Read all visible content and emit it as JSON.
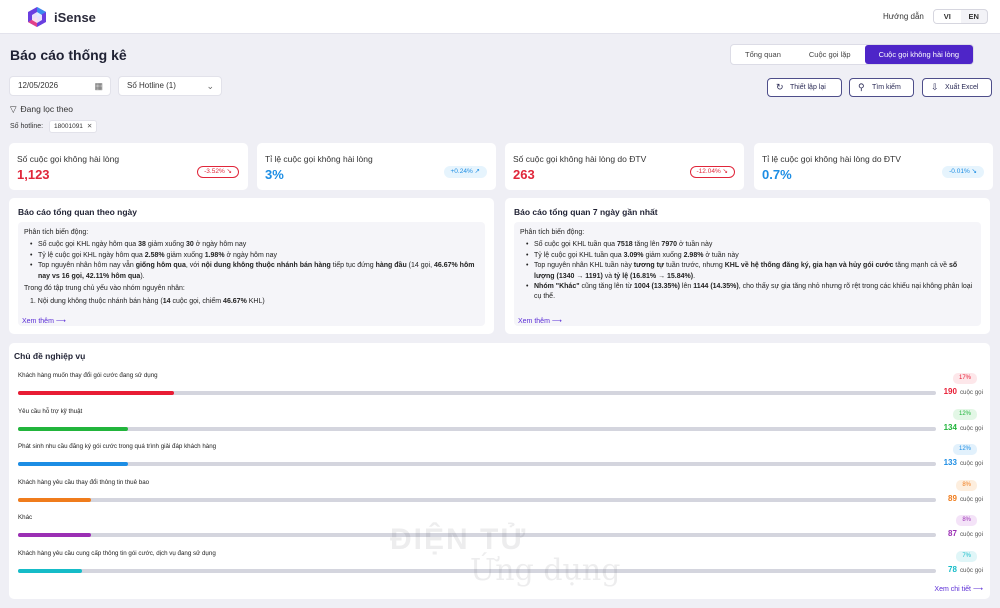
{
  "app": {
    "brand": "iSense",
    "guide": "Hướng dẫn",
    "lang_vi": "VI",
    "lang_en": "EN"
  },
  "page": {
    "title": "Báo cáo thống kê"
  },
  "tabs": [
    {
      "label": "Tổng quan",
      "active": false
    },
    {
      "label": "Cuộc gọi lặp",
      "active": false
    },
    {
      "label": "Cuộc gọi không hài lòng",
      "active": true
    }
  ],
  "filters": {
    "date": "12/05/2026",
    "hotline_select": "Số Hotline (1)",
    "active_label": "Đang lọc theo",
    "hotline_label": "Số hotline:",
    "hotline_chip": "18001091"
  },
  "actions": {
    "reset": "Thiết lập lại",
    "search": "Tìm kiếm",
    "export": "Xuất Excel"
  },
  "kpis": [
    {
      "label": "Số cuộc gọi không hài lòng",
      "value": "1,123",
      "badge": "-3.52%",
      "trend": "down",
      "value_color": "#e0263a"
    },
    {
      "label": "Tỉ lệ cuộc gọi không hài lòng",
      "value": "3%",
      "badge": "+0.24%",
      "trend": "up",
      "value_color": "#1c8de4"
    },
    {
      "label": "Số cuộc gọi không hài lòng do ĐTV",
      "value": "263",
      "badge": "-12.04%",
      "trend": "down",
      "value_color": "#e0263a"
    },
    {
      "label": "Tỉ lệ cuộc gọi không hài lòng do ĐTV",
      "value": "0.7%",
      "badge": "-0.01%",
      "trend": "up",
      "value_color": "#1c8de4"
    }
  ],
  "daily": {
    "title": "Báo cáo tổng quan theo ngày",
    "lead": "Phân tích biến động:",
    "b1": [
      "Số cuộc gọi KHL ngày hôm qua ",
      "38",
      " giảm xuống ",
      "30",
      " ở ngày hôm nay"
    ],
    "b2": [
      "Tỷ lệ cuộc gọi KHL ngày hôm qua ",
      "2.58%",
      " giảm xuống ",
      "1.98%",
      " ở ngày hôm nay"
    ],
    "b3": [
      "Top nguyên nhân hôm nay vẫn ",
      "giống hôm qua",
      ", với ",
      "nội dung không thuộc nhánh bán hàng",
      " tiếp tục đứng ",
      "hàng đầu",
      " (14 gọi, ",
      "46.67% hôm nay vs 16 gọi, 42.11% hôm qua",
      ")."
    ],
    "focus": "Trong đó tập trung chủ yếu vào nhóm nguyên nhân:",
    "item": [
      "1. Nội dung không thuộc nhánh bán hàng (",
      "14",
      " cuộc gọi, chiếm ",
      "46.67%",
      " KHL)"
    ],
    "more": "Xem thêm"
  },
  "weekly": {
    "title": "Báo cáo tổng quan 7 ngày gần nhất",
    "lead": "Phân tích biến động:",
    "b1": [
      "Số cuộc gọi KHL tuần qua ",
      "7518",
      " tăng lên ",
      "7970",
      " ở tuần này"
    ],
    "b2": [
      "Tỷ lệ cuộc gọi KHL tuần qua ",
      "3.09%",
      " giảm xuống ",
      "2.98%",
      " ở tuần này"
    ],
    "b3": [
      "Top nguyên nhân KHL tuần này ",
      "tương tự",
      " tuần trước, nhưng ",
      "KHL về hệ thống đăng ký, gia hạn và hủy gói cước",
      " tăng mạnh cả về ",
      "số lượng (1340 → 1191)",
      " và ",
      "tỷ lệ (16.81% → 15.84%)",
      "."
    ],
    "b4": [
      "Nhóm \"Khác\"",
      " cũng tăng lên từ ",
      "1004 (13.35%)",
      " lên ",
      "1144 (14.35%)",
      ", cho thấy sự gia tăng nhỏ nhưng rõ rệt trong các khiếu nại không phân loại cụ thể."
    ],
    "more": "Xem thêm"
  },
  "topics": {
    "title": "Chủ đề nghiệp vụ",
    "unit": "cuộc gọi",
    "see_all": "Xem chi tiết",
    "items": [
      {
        "label": "Khách hàng muốn thay đổi gói cước đang sử dụng",
        "percent": "17%",
        "count": "190",
        "share": 0.17,
        "color": "#e81c34",
        "badge_bg": "#fde7ea"
      },
      {
        "label": "Yêu cầu hỗ trợ kỹ thuật",
        "percent": "12%",
        "count": "134",
        "share": 0.12,
        "color": "#22b53c",
        "badge_bg": "#e3f7e6"
      },
      {
        "label": "Phát sinh nhu cầu đăng ký gói cước trong quá trình giải đáp khách hàng",
        "percent": "12%",
        "count": "133",
        "share": 0.12,
        "color": "#1c8de4",
        "badge_bg": "#e2f1fc"
      },
      {
        "label": "Khách hàng yêu cầu thay đổi thông tin thuê bao",
        "percent": "8%",
        "count": "89",
        "share": 0.08,
        "color": "#f07c1c",
        "badge_bg": "#fdeede"
      },
      {
        "label": "Khác",
        "percent": "8%",
        "count": "87",
        "share": 0.08,
        "color": "#9b2fb4",
        "badge_bg": "#f4e3f8"
      },
      {
        "label": "Khách hàng yêu cầu cung cấp thông tin gói cước, dịch vụ đang sử dụng",
        "percent": "7%",
        "count": "78",
        "share": 0.07,
        "color": "#16bcc8",
        "badge_bg": "#e0f6f8"
      }
    ]
  },
  "watermark": {
    "line1": "ĐIỆN TỬ",
    "line2": "Ứng dụng"
  }
}
